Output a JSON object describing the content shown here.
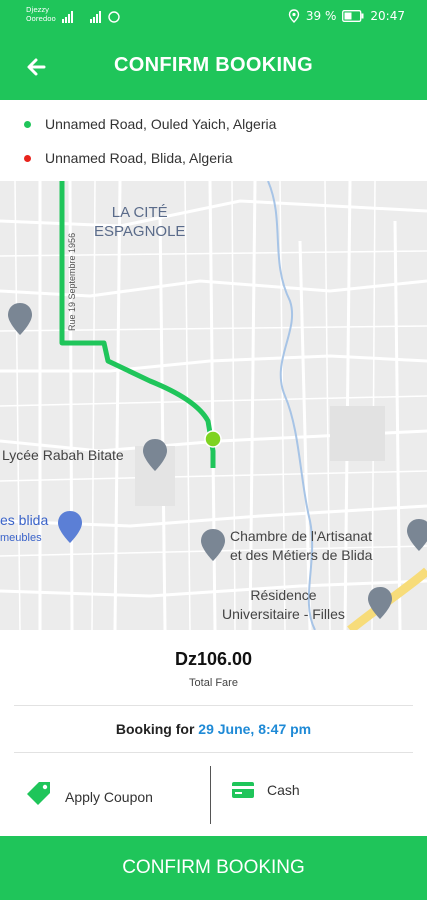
{
  "status_bar": {
    "carrier_line1": "Djezzy",
    "carrier_line2": "Ooredoo",
    "battery_percent": "39 %",
    "time": "20:47"
  },
  "app_bar": {
    "title": "CONFIRM BOOKING",
    "back_icon": "arrow-left-icon"
  },
  "route": {
    "pickup": "Unnamed Road, Ouled Yaich, Algeria",
    "dropoff": "Unnamed Road, Blida, Algeria",
    "pickup_color": "#1fc55a",
    "dropoff_color": "#e8231c"
  },
  "map": {
    "labels": {
      "district_line1": "LA CITÉ",
      "district_line2": "ESPAGNOLE",
      "street": "Rue 19 Septembre 1956",
      "school": "Lycée Rabah Bitate",
      "shop_line1": "es blida",
      "shop_line2": "meubles",
      "chamber_line1": "Chambre de l'Artisanat",
      "chamber_line2": "et des Métiers de Blida",
      "residence_line1": "Résidence",
      "residence_line2": "Universitaire - Filles"
    },
    "route_color": "#1fc55a"
  },
  "fare": {
    "amount": "Dz106.00",
    "label": "Total Fare"
  },
  "booking": {
    "prefix": "Booking for ",
    "datetime": "29 June, 8:47 pm",
    "datetime_color": "#1f8ad6"
  },
  "options": {
    "coupon_label": "Apply Coupon",
    "coupon_icon": "tag-icon",
    "payment_label": "Cash",
    "payment_icon": "cash-icon"
  },
  "confirm_button": {
    "label": "CONFIRM BOOKING"
  },
  "colors": {
    "brand": "#1fc55a"
  }
}
